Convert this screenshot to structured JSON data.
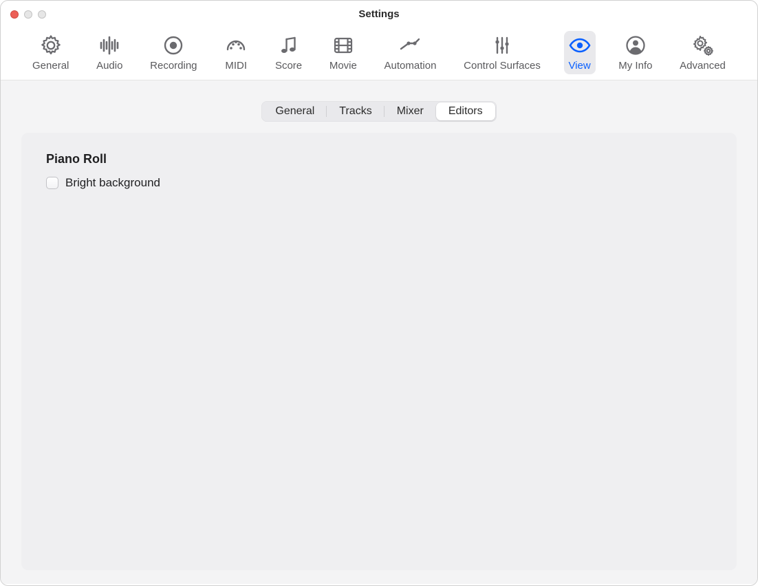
{
  "window": {
    "title": "Settings"
  },
  "toolbar": {
    "items": [
      {
        "id": "general",
        "label": "General"
      },
      {
        "id": "audio",
        "label": "Audio"
      },
      {
        "id": "recording",
        "label": "Recording"
      },
      {
        "id": "midi",
        "label": "MIDI"
      },
      {
        "id": "score",
        "label": "Score"
      },
      {
        "id": "movie",
        "label": "Movie"
      },
      {
        "id": "automation",
        "label": "Automation"
      },
      {
        "id": "control-surfaces",
        "label": "Control Surfaces"
      },
      {
        "id": "view",
        "label": "View",
        "active": true
      },
      {
        "id": "my-info",
        "label": "My Info"
      },
      {
        "id": "advanced",
        "label": "Advanced"
      }
    ]
  },
  "tabs": {
    "items": [
      {
        "id": "general",
        "label": "General"
      },
      {
        "id": "tracks",
        "label": "Tracks"
      },
      {
        "id": "mixer",
        "label": "Mixer"
      },
      {
        "id": "editors",
        "label": "Editors",
        "active": true
      }
    ]
  },
  "panel": {
    "section_title": "Piano Roll",
    "options": [
      {
        "id": "bright-background",
        "label": "Bright background",
        "checked": false
      }
    ]
  }
}
